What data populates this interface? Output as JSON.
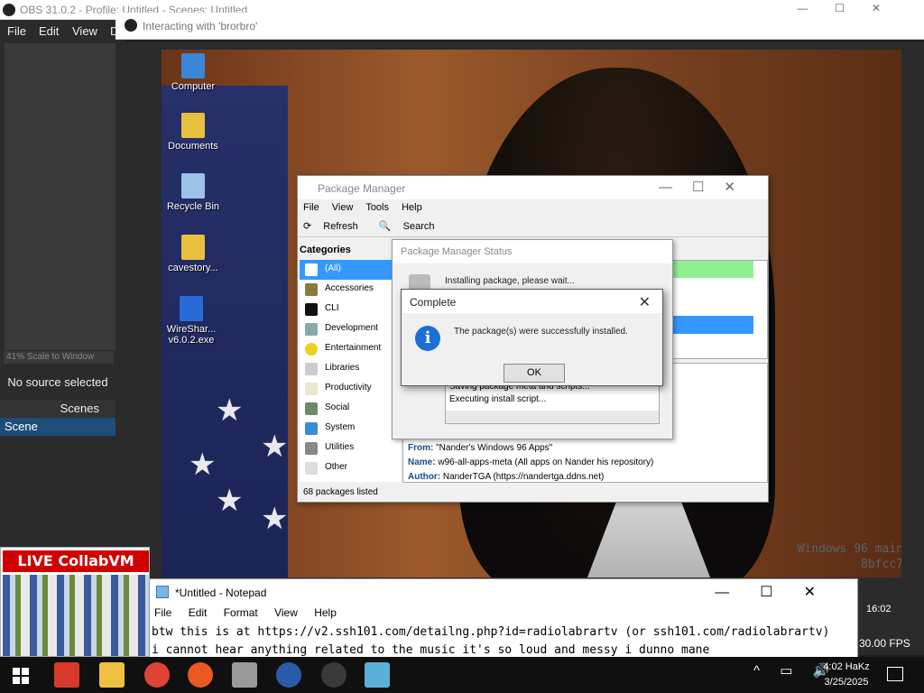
{
  "obs": {
    "window_title": "OBS 31.0.2 - Profile: Untitled - Scenes: Untitled",
    "menu": [
      "File",
      "Edit",
      "View",
      "D"
    ],
    "scale_text": "41% Scale to Window",
    "no_source": "No source selected",
    "scenes_header": "Scenes",
    "scene_item": "Scene",
    "fps": "30.00 FPS",
    "preview_time": "16:02",
    "interacting_title": "Interacting with 'brorbro'"
  },
  "desktop": {
    "icons": [
      {
        "label": "Computer",
        "color": "#3a86d8"
      },
      {
        "label": "Documents",
        "color": "#e8c040"
      },
      {
        "label": "Recycle Bin",
        "color": "#9cc2e8"
      },
      {
        "label": "cavestory...",
        "color": "#e8c040"
      },
      {
        "label": "WireShar... v6.0.2.exe",
        "color": "#2a6ad8"
      }
    ],
    "watermark_line1": "Windows 96 main",
    "watermark_line2": "8bfcc7"
  },
  "package_manager": {
    "title": "Package Manager",
    "menu": [
      "File",
      "View",
      "Tools",
      "Help"
    ],
    "toolbar": {
      "refresh": "Refresh",
      "search": "Search"
    },
    "categories_header": "Categories",
    "categories": [
      "(All)",
      "Accessories",
      "CLI",
      "Development",
      "Entertainment",
      "Libraries",
      "Productivity",
      "Social",
      "System",
      "Utilities",
      "Other"
    ],
    "details": {
      "from_label": "From:",
      "from_value": "\"Nander's Windows 96 Apps\"",
      "name_label": "Name:",
      "name_value": "w96-all-apps-meta (All apps on Nander his repository)",
      "author_label": "Author:",
      "author_value": "NanderTGA (https://nandertga.ddns.net)"
    },
    "status": "68 packages listed"
  },
  "status_window": {
    "title": "Package Manager Status",
    "message": "Installing package, please wait...",
    "log": [
      "Saving package meta and scripts...",
      "Executing install script..."
    ]
  },
  "complete_dialog": {
    "title": "Complete",
    "message": "The package(s) were successfully installed.",
    "ok": "OK",
    "icon_glyph": "i"
  },
  "reaction": {
    "title": "LIVE CollabVM REACTION"
  },
  "notepad": {
    "title": "*Untitled - Notepad",
    "menu": [
      "File",
      "Edit",
      "Format",
      "View",
      "Help"
    ],
    "line1": "btw this is at https://v2.ssh101.com/detailng.php?id=radiolabrartv (or ssh101.com/radiolabrartv)",
    "line2": "i cannot hear anything related to the music it's so loud and messy i dunno mane"
  },
  "taskbar": {
    "clock_time": "4:02 HaKz",
    "clock_date": "3/25/2025",
    "apps": [
      {
        "name": "app-red-icon",
        "color": "#d83a2a"
      },
      {
        "name": "file-explorer-icon",
        "color": "#f0c040"
      },
      {
        "name": "chrome-icon",
        "color": "#dd4433"
      },
      {
        "name": "app-swirl-icon",
        "color": "#e85a20"
      },
      {
        "name": "app-gray-icon",
        "color": "#9a9a9a"
      },
      {
        "name": "app-blue-icon",
        "color": "#2a5aaa"
      },
      {
        "name": "obs-icon",
        "color": "#3a3a3a"
      },
      {
        "name": "app-active-icon",
        "color": "#5ab0d8"
      }
    ]
  }
}
